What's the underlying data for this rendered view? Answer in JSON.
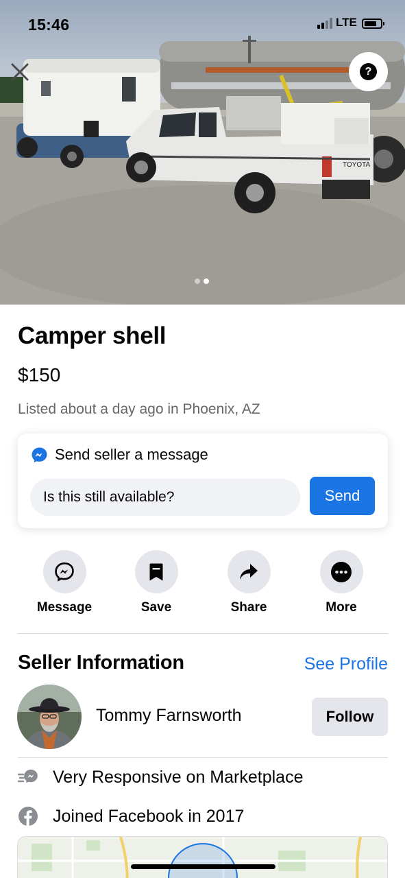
{
  "status_bar": {
    "time": "15:46",
    "network": "LTE"
  },
  "gallery": {
    "image_count": 2,
    "active_index": 1,
    "scene_text": "TOYOTA"
  },
  "listing": {
    "title": "Camper shell",
    "price": "$150",
    "listed": "Listed about a day ago in Phoenix, AZ"
  },
  "message_card": {
    "heading": "Send seller a message",
    "input_value": "Is this still available?",
    "send_label": "Send"
  },
  "actions": [
    {
      "label": "Message",
      "icon": "messenger-icon"
    },
    {
      "label": "Save",
      "icon": "bookmark-icon"
    },
    {
      "label": "Share",
      "icon": "share-arrow-icon"
    },
    {
      "label": "More",
      "icon": "more-dots-icon"
    }
  ],
  "seller": {
    "heading": "Seller Information",
    "see_profile": "See Profile",
    "name": "Tommy Farnsworth",
    "follow_label": "Follow",
    "responsive": "Very Responsive on Marketplace",
    "joined": "Joined Facebook in 2017"
  },
  "colors": {
    "accent": "#1b74e4",
    "secondary_text": "#65676b",
    "button_gray": "#e4e6eb",
    "input_bg": "#f0f2f5"
  }
}
